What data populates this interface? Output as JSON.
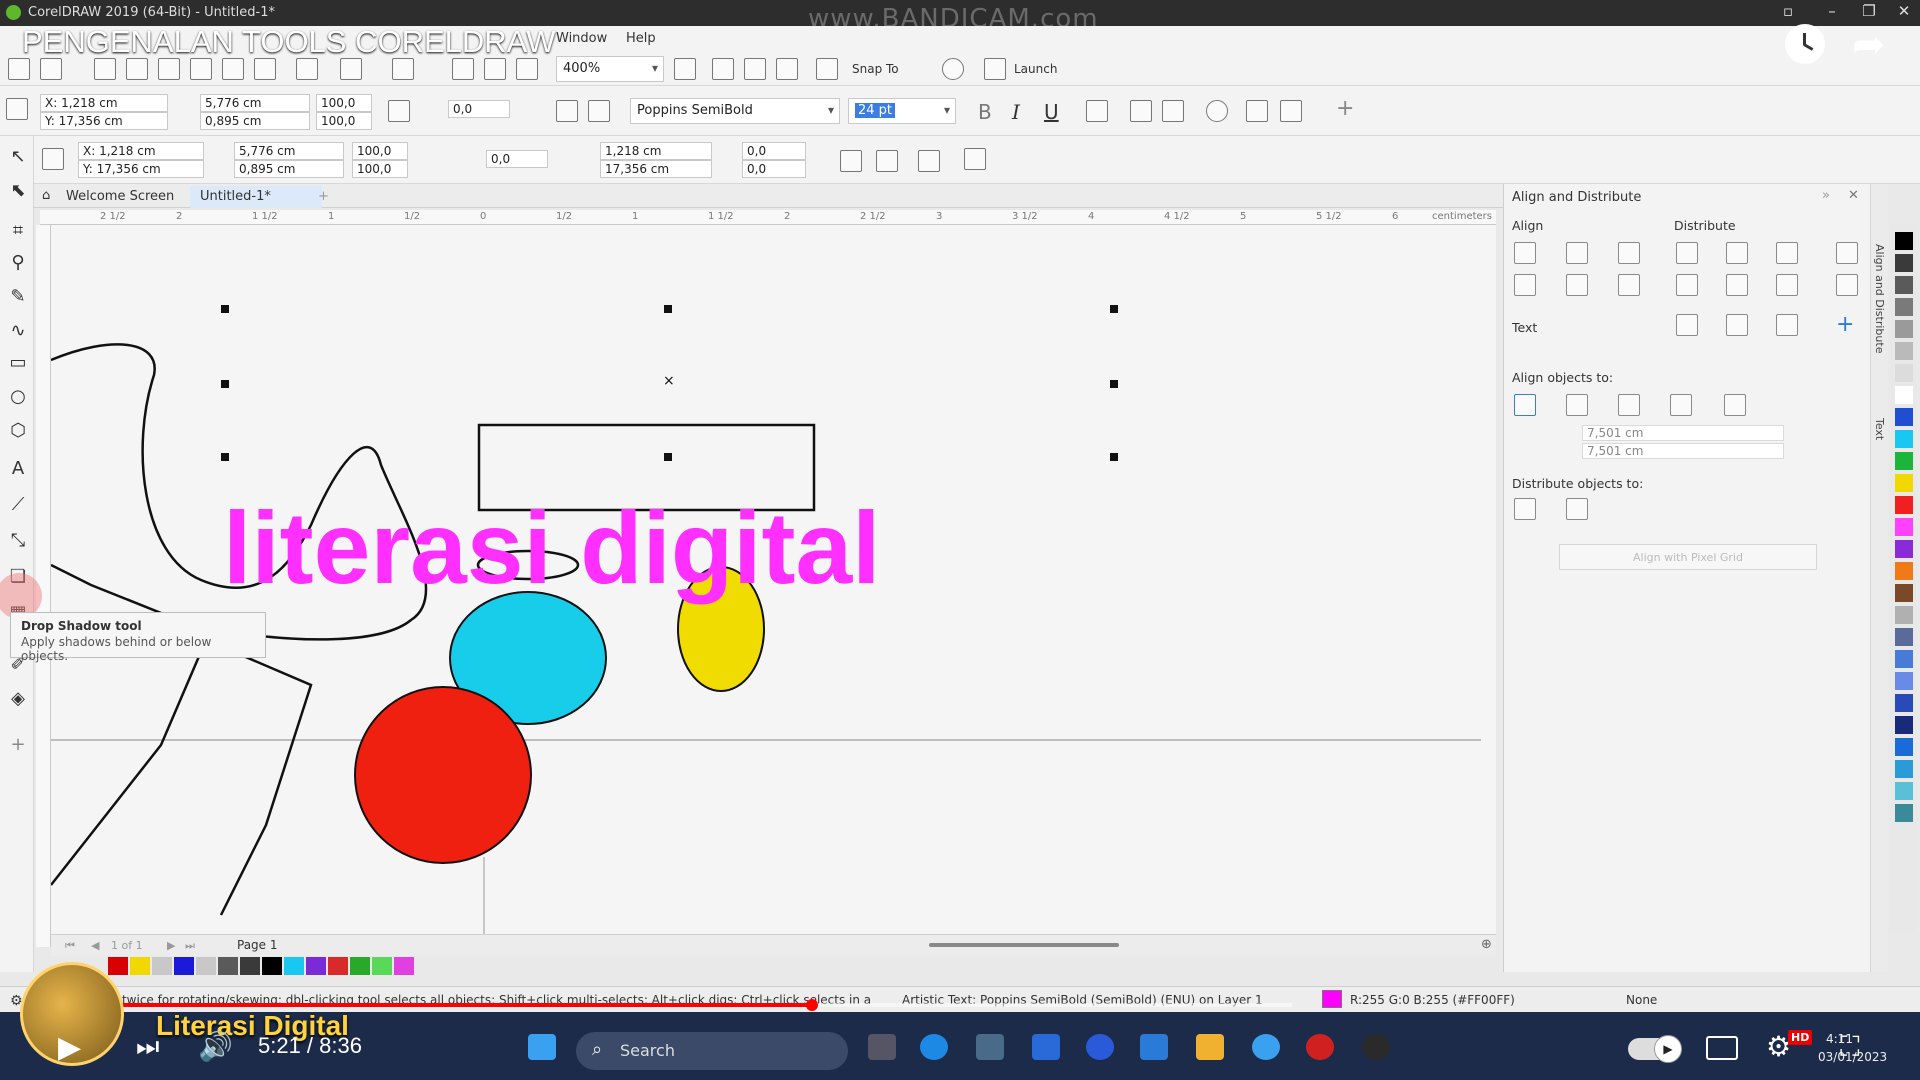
{
  "window": {
    "title": "CorelDRAW 2019 (64-Bit) - Untitled-1*",
    "watermark": "www.BANDICAM.com"
  },
  "video": {
    "title": "PENGENALAN TOOLS CORELDRAW",
    "channel_name": "Literasi Digital",
    "timecode": "5:21 / 8:36",
    "progress_fraction": 0.62,
    "hd_badge": "HD"
  },
  "menu": {
    "items": [
      "Window",
      "Help"
    ]
  },
  "toolbar": {
    "zoom": "400%",
    "snap_to": "Snap To",
    "launch": "Launch",
    "x_pos": "X: 1,218 cm",
    "y_pos": "Y: 17,356 cm",
    "width": "5,776 cm",
    "height": "0,895 cm",
    "scale_w": "100,0",
    "scale_h": "100,0",
    "percent": "%",
    "rotation": "0,0",
    "font_name": "Poppins SemiBold",
    "font_size": "24 pt",
    "bold": "B",
    "italic": "I",
    "underline": "U",
    "t3_x": "1,218 cm",
    "t3_y": "17,356 cm",
    "t3_w": "5,776 cm",
    "t3_h": "0,895 cm",
    "t3_sx": "100,0",
    "t3_sy": "100,0",
    "t3_rot": "0,0",
    "t3_cx": "1,218 cm",
    "t3_cy": "17,356 cm",
    "t3_px": "0,0",
    "t3_py": "0,0"
  },
  "tabs": [
    {
      "label": "Welcome Screen"
    },
    {
      "label": "Untitled-1*"
    }
  ],
  "ruler": {
    "unit": "centimeters",
    "ticks": [
      "2 1/2",
      "2",
      "1 1/2",
      "1",
      "1/2",
      "0",
      "1/2",
      "1",
      "1 1/2",
      "2",
      "2 1/2",
      "3",
      "3 1/2",
      "4",
      "4 1/2",
      "5",
      "5 1/2",
      "6"
    ]
  },
  "canvas": {
    "text": "literasi digital",
    "text_color": "#FF30FF"
  },
  "tooltip": {
    "title": "Drop Shadow tool",
    "description": "Apply shadows behind or below objects."
  },
  "docker": {
    "title": "Align and Distribute",
    "align_label": "Align",
    "distribute_label": "Distribute",
    "text_label": "Text",
    "align_objects_to": "Align objects to:",
    "x_val": "7,501 cm",
    "y_val": "7,501 cm",
    "distribute_objects_to": "Distribute objects to:",
    "pixel_grid_button": "Align with Pixel Grid",
    "vtab_1": "Align and Distribute",
    "vtab_2": "Text"
  },
  "page_nav": {
    "counter": "1 of 1",
    "page_label": "Page 1"
  },
  "status": {
    "hint": "Click an object twice for rotating/skewing; dbl-clicking tool selects all objects; Shift+click multi-selects; Alt+click digs; Ctrl+click selects in a group",
    "object_info": "Artistic Text: Poppins SemiBold (SemiBold) (ENU) on Layer 1",
    "fill_info": "R:255 G:0 B:255 (#FF00FF)",
    "outline_info": "None"
  },
  "taskbar": {
    "search_placeholder": "Search",
    "time": "4:11",
    "date": "03/01/2023"
  },
  "palette_colors": [
    "#000000",
    "#3a3a3a",
    "#5a5a5a",
    "#7a7a7a",
    "#9a9a9a",
    "#bababa",
    "#dcdcdc",
    "#ffffff",
    "#1f4fd0",
    "#18c8f0",
    "#1cb43a",
    "#f0d800",
    "#f02020",
    "#ff40ff",
    "#8a2ad8",
    "#f07a18",
    "#7a4a28",
    "#b0b0b0",
    "#5a6a9a",
    "#4a7ad8",
    "#6a8ae8",
    "#2a4ab8",
    "#1a2a7a",
    "#1a6ad8",
    "#2a9ad8",
    "#5ac0d8",
    "#3a8a9a"
  ],
  "doc_palette": [
    "#d80000",
    "#f0d800",
    "#c8c8c8",
    "#1a1ad8",
    "#c8c8c8",
    "#5a5a5a",
    "#3a3a3a",
    "#000000",
    "#18c8f0",
    "#7a2ad8",
    "#d82a2a",
    "#2aa82a",
    "#5ad85a",
    "#e040e0"
  ]
}
